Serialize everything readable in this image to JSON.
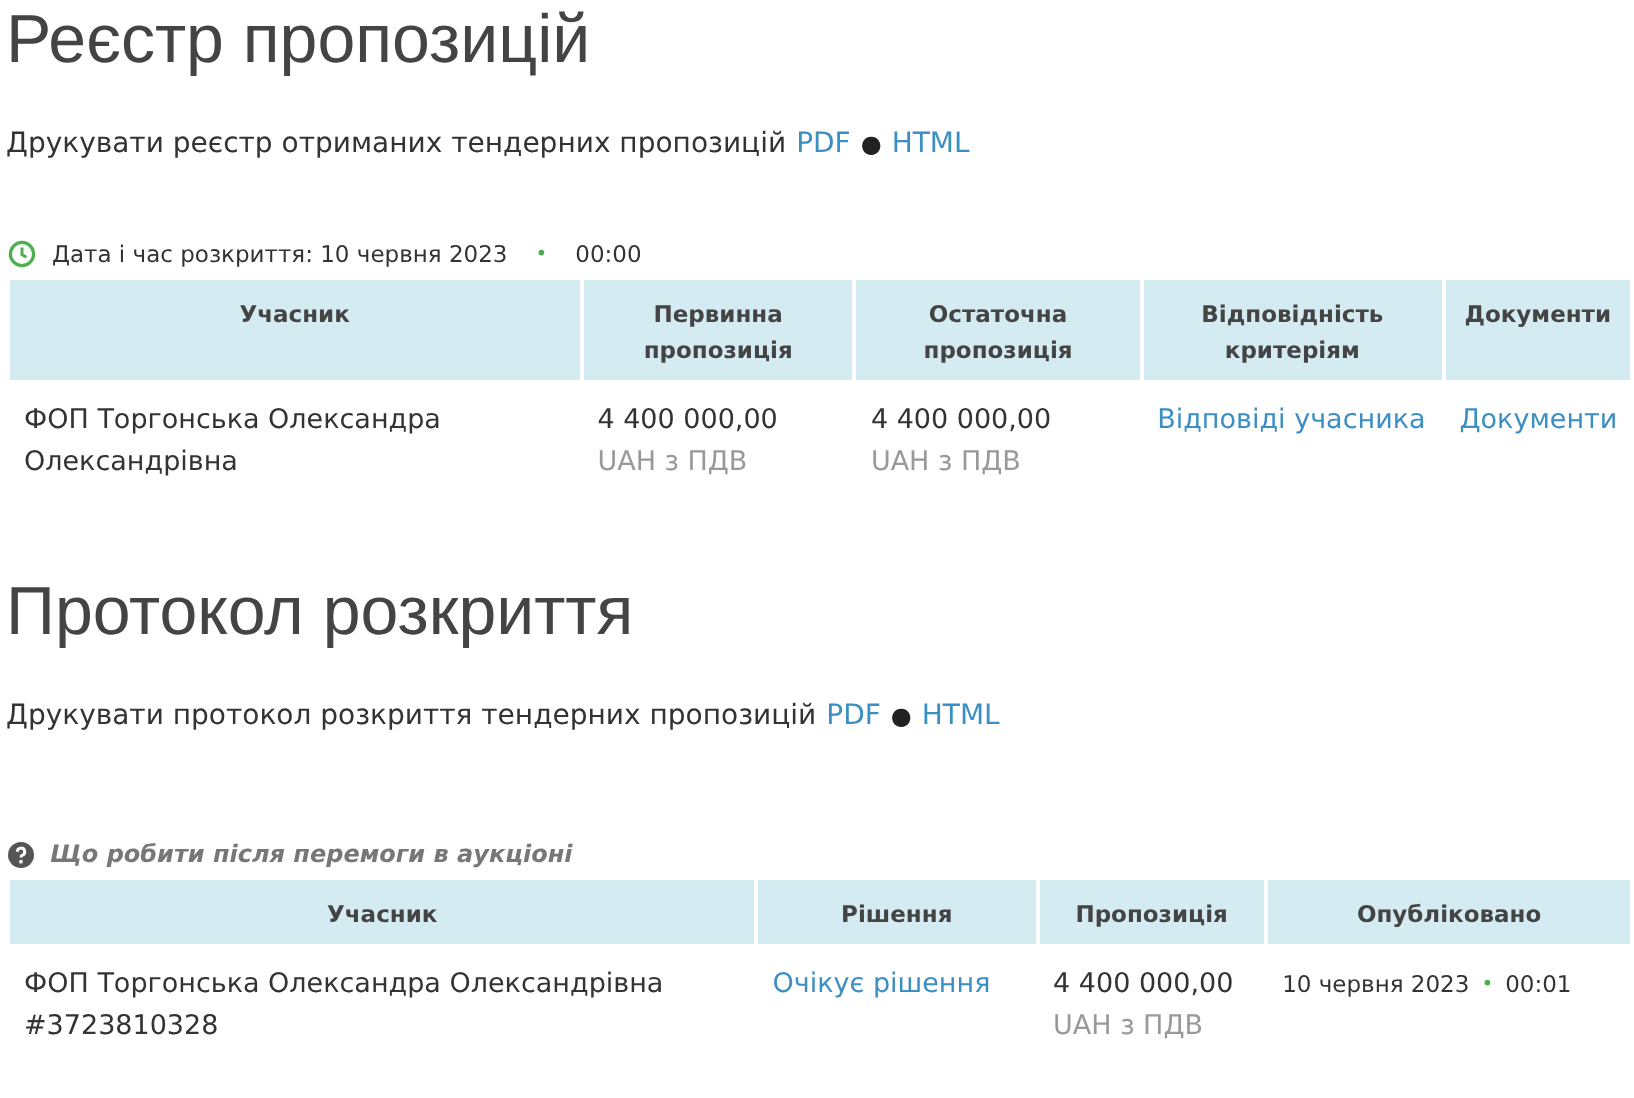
{
  "sections": [
    {
      "title": "Реєстр пропозицій",
      "print": {
        "text": "Друкувати реєстр отриманих тендерних пропозицій",
        "links": [
          "PDF",
          "HTML"
        ],
        "separator": "●"
      },
      "note": {
        "kind": "clock",
        "parts": [
          "Дата і час розкриття: 10 червня 2023",
          "•",
          "00:00"
        ]
      },
      "table": {
        "columns": [
          "Учасник",
          "Первинна пропозиція",
          "Остаточна пропозиція",
          "Відповідність критеріям",
          "Документи"
        ],
        "rows": [
          [
            {
              "kind": "text",
              "lines": [
                "ФОП Торгонська Олександра",
                "Олександрівна"
              ]
            },
            {
              "kind": "amount",
              "lines": [
                "4 400 000,00",
                "UAH з ПДВ"
              ]
            },
            {
              "kind": "amount",
              "lines": [
                "4 400 000,00",
                "UAH з ПДВ"
              ]
            },
            {
              "kind": "link",
              "lines": [
                "Відповіді учасника"
              ]
            },
            {
              "kind": "link",
              "lines": [
                "Документи"
              ]
            }
          ]
        ]
      }
    },
    {
      "title": "Протокол розкриття",
      "print": {
        "text": "Друкувати протокол розкриття тендерних пропозицій",
        "links": [
          "PDF",
          "HTML"
        ],
        "separator": "●"
      },
      "note": {
        "kind": "help",
        "parts": [
          "Що робити після перемоги в аукціоні"
        ]
      },
      "table": {
        "columns": [
          "Учасник",
          "Рішення",
          "Пропозиція",
          "Опубліковано"
        ],
        "rows": [
          [
            {
              "kind": "text",
              "lines": [
                "ФОП Торгонська Олександра Олександрівна",
                "#3723810328"
              ]
            },
            {
              "kind": "link",
              "lines": [
                "Очікує рішення"
              ]
            },
            {
              "kind": "amount",
              "lines": [
                "4 400 000,00",
                "UAH з ПДВ"
              ]
            },
            {
              "kind": "datetime",
              "lines": [
                "10 червня 2023",
                "•",
                "00:01"
              ]
            }
          ]
        ]
      }
    }
  ]
}
